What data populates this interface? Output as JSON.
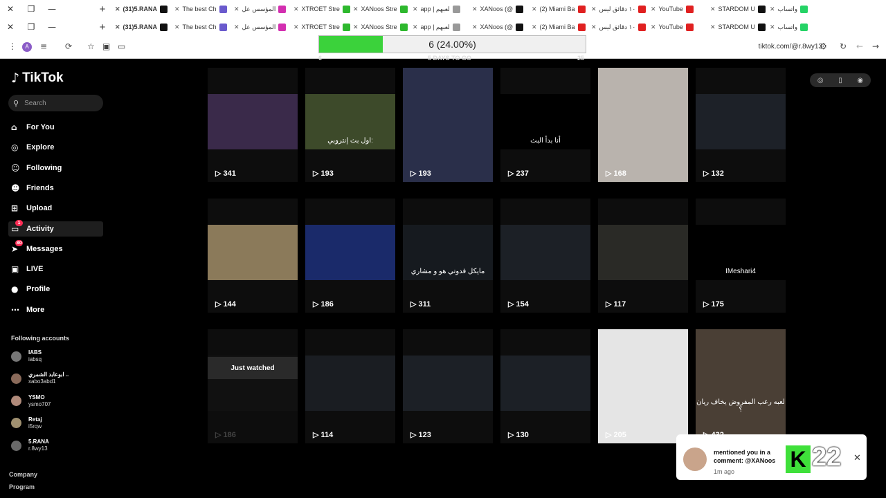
{
  "browser": {
    "tabs": [
      {
        "label": "(31)5.RANA",
        "color": "#111111",
        "active": true
      },
      {
        "label": "The best Ch",
        "color": "#6a5acd"
      },
      {
        "label": "المؤسس عل",
        "color": "#d32fb0"
      },
      {
        "label": "XTROET Stre",
        "color": "#2eb82e"
      },
      {
        "label": "XANoos Stre",
        "color": "#2eb82e"
      },
      {
        "label": "app | لعبهم",
        "color": "#999999"
      },
      {
        "label": "XANoos (@",
        "color": "#111111"
      },
      {
        "label": "(2) Miami Ba",
        "color": "#e02020"
      },
      {
        "label": "١٠ دقائق ليس",
        "color": "#e02020"
      },
      {
        "label": "YouTube",
        "color": "#e02020"
      },
      {
        "label": "STARDOM U",
        "color": "#111111"
      },
      {
        "label": "واتساب",
        "color": "#25d366"
      }
    ],
    "progress": {
      "label": "6 (24.00%)",
      "value": 0.24
    },
    "url": "tiktok.com/@r.8wy13",
    "profile_initial": "A"
  },
  "sidebar": {
    "logo": "TikTok",
    "search_placeholder": "Search",
    "nav": [
      {
        "label": "For You",
        "icon": "home-icon",
        "glyph": "⌂"
      },
      {
        "label": "Explore",
        "icon": "compass-icon",
        "glyph": "◎"
      },
      {
        "label": "Following",
        "icon": "following-icon",
        "glyph": "☺"
      },
      {
        "label": "Friends",
        "icon": "friends-icon",
        "glyph": "☻"
      },
      {
        "label": "Upload",
        "icon": "upload-icon",
        "glyph": "⊞"
      },
      {
        "label": "Activity",
        "icon": "activity-icon",
        "glyph": "▭",
        "badge": "1",
        "active": true
      },
      {
        "label": "Messages",
        "icon": "messages-icon",
        "glyph": "➤",
        "badge": "30"
      },
      {
        "label": "LIVE",
        "icon": "live-icon",
        "glyph": "▣"
      },
      {
        "label": "Profile",
        "icon": "profile-icon",
        "glyph": "●"
      },
      {
        "label": "More",
        "icon": "more-icon",
        "glyph": "⋯"
      }
    ],
    "following_title": "Following accounts",
    "accounts": [
      {
        "name": "IABS",
        "handle": "iabsq",
        "color": "#777777"
      },
      {
        "name": "ابوعابد الشمري ..",
        "handle": "xabo3abd1",
        "color": "#8a6a5a"
      },
      {
        "name": "YSMO",
        "handle": "ysmo707",
        "color": "#b08a7a"
      },
      {
        "name": "Retaj",
        "handle": "i5rqw",
        "color": "#a09070"
      },
      {
        "name": "5.RANA ㅤ",
        "handle": "r.8wy13",
        "color": "#6a6a6a"
      }
    ],
    "footer": [
      "Company",
      "Program"
    ]
  },
  "header_numbers": [
    "6",
    "5 DAYS TO GO",
    "25"
  ],
  "videos": [
    {
      "views": "341",
      "thumb_color": "#3a2a4a",
      "caption": ""
    },
    {
      "views": "193",
      "thumb_color": "#3d4a2a",
      "caption": "اول بث إنتروبي:"
    },
    {
      "views": "193",
      "thumb_color": "#2a2f4a",
      "caption": ""
    },
    {
      "views": "237",
      "thumb_color": "#000000",
      "caption": "أنا بدأ البث"
    },
    {
      "views": "168",
      "thumb_color": "#b9b3ad",
      "caption": ""
    },
    {
      "views": "132",
      "thumb_color": "#1d2128",
      "caption": ""
    },
    {
      "views": "144",
      "thumb_color": "#8b7a5a",
      "caption": ""
    },
    {
      "views": "186",
      "thumb_color": "#1a2a6a",
      "caption": ""
    },
    {
      "views": "311",
      "thumb_color": "#161a1f",
      "caption": "مايكل قدوتي هو و مشاري"
    },
    {
      "views": "154",
      "thumb_color": "#1c2026",
      "caption": ""
    },
    {
      "views": "117",
      "thumb_color": "#2a2a26",
      "caption": ""
    },
    {
      "views": "175",
      "thumb_color": "#000000",
      "caption": "IMeshari4"
    },
    {
      "views": "186",
      "thumb_color": "#111111",
      "caption": "",
      "watched": "Just watched"
    },
    {
      "views": "114",
      "thumb_color": "#1a1d22",
      "caption": ""
    },
    {
      "views": "123",
      "thumb_color": "#1c2026",
      "caption": ""
    },
    {
      "views": "130",
      "thumb_color": "#1c2026",
      "caption": ""
    },
    {
      "views": "205",
      "thumb_color": "#e5e5e5",
      "caption": ""
    },
    {
      "views": "432",
      "thumb_color": "#4a3f35",
      "caption": "لعبه رعب المفروض يخاف ريان ؟"
    }
  ],
  "notification": {
    "text": "mentioned you in a comment: @XANoos",
    "time": "1m ago",
    "overlay_number": "22"
  }
}
